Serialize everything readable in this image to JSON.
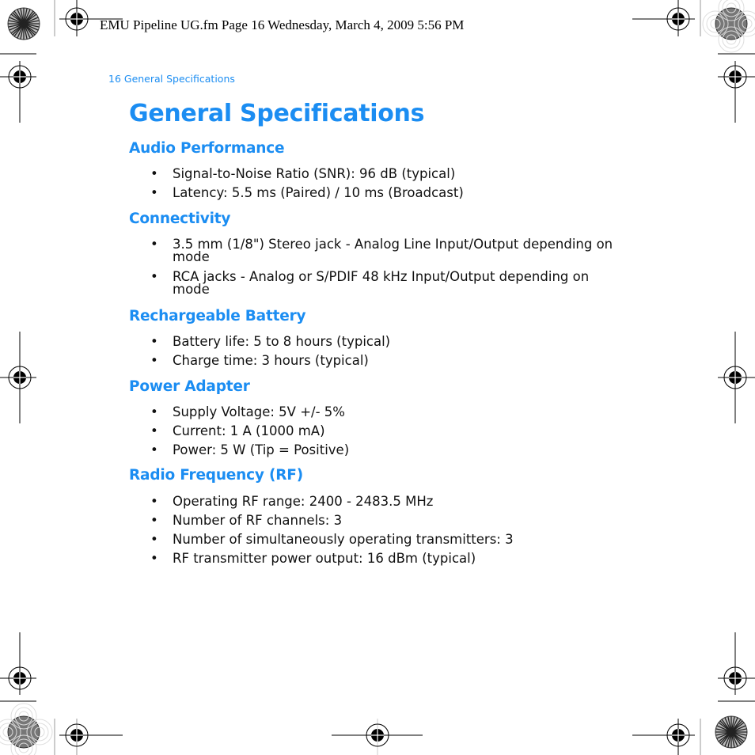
{
  "print_slug": "EMU Pipeline UG.fm  Page 16  Wednesday, March 4, 2009  5:56 PM",
  "running_header": "16  General Specifications",
  "page_title": "General Specifications",
  "bullet_glyph": "•",
  "sections": [
    {
      "heading": "Audio Performance",
      "items": [
        "Signal-to-Noise Ratio (SNR): 96 dB (typical)",
        "Latency: 5.5 ms (Paired) / 10 ms  (Broadcast)"
      ]
    },
    {
      "heading": "Connectivity",
      "items": [
        "3.5 mm (1/8\") Stereo jack - Analog Line Input/Output depending on mode",
        "RCA jacks - Analog or S/PDIF 48 kHz Input/Output depending on mode"
      ]
    },
    {
      "heading": "Rechargeable Battery",
      "items": [
        "Battery life: 5 to 8 hours (typical)",
        "Charge time: 3 hours (typical)"
      ]
    },
    {
      "heading": "Power Adapter",
      "items": [
        "Supply Voltage: 5V +/- 5%",
        "Current: 1 A (1000 mA)",
        "Power: 5 W (Tip = Positive)"
      ]
    },
    {
      "heading": "Radio Frequency (RF)",
      "items": [
        "Operating RF range: 2400 - 2483.5 MHz",
        "Number of RF channels: 3",
        "Number of simultaneously operating transmitters: 3",
        "RF transmitter power output: 16 dBm (typical)"
      ]
    }
  ],
  "colors": {
    "accent": "#1b8df2",
    "body_text": "#111111"
  }
}
